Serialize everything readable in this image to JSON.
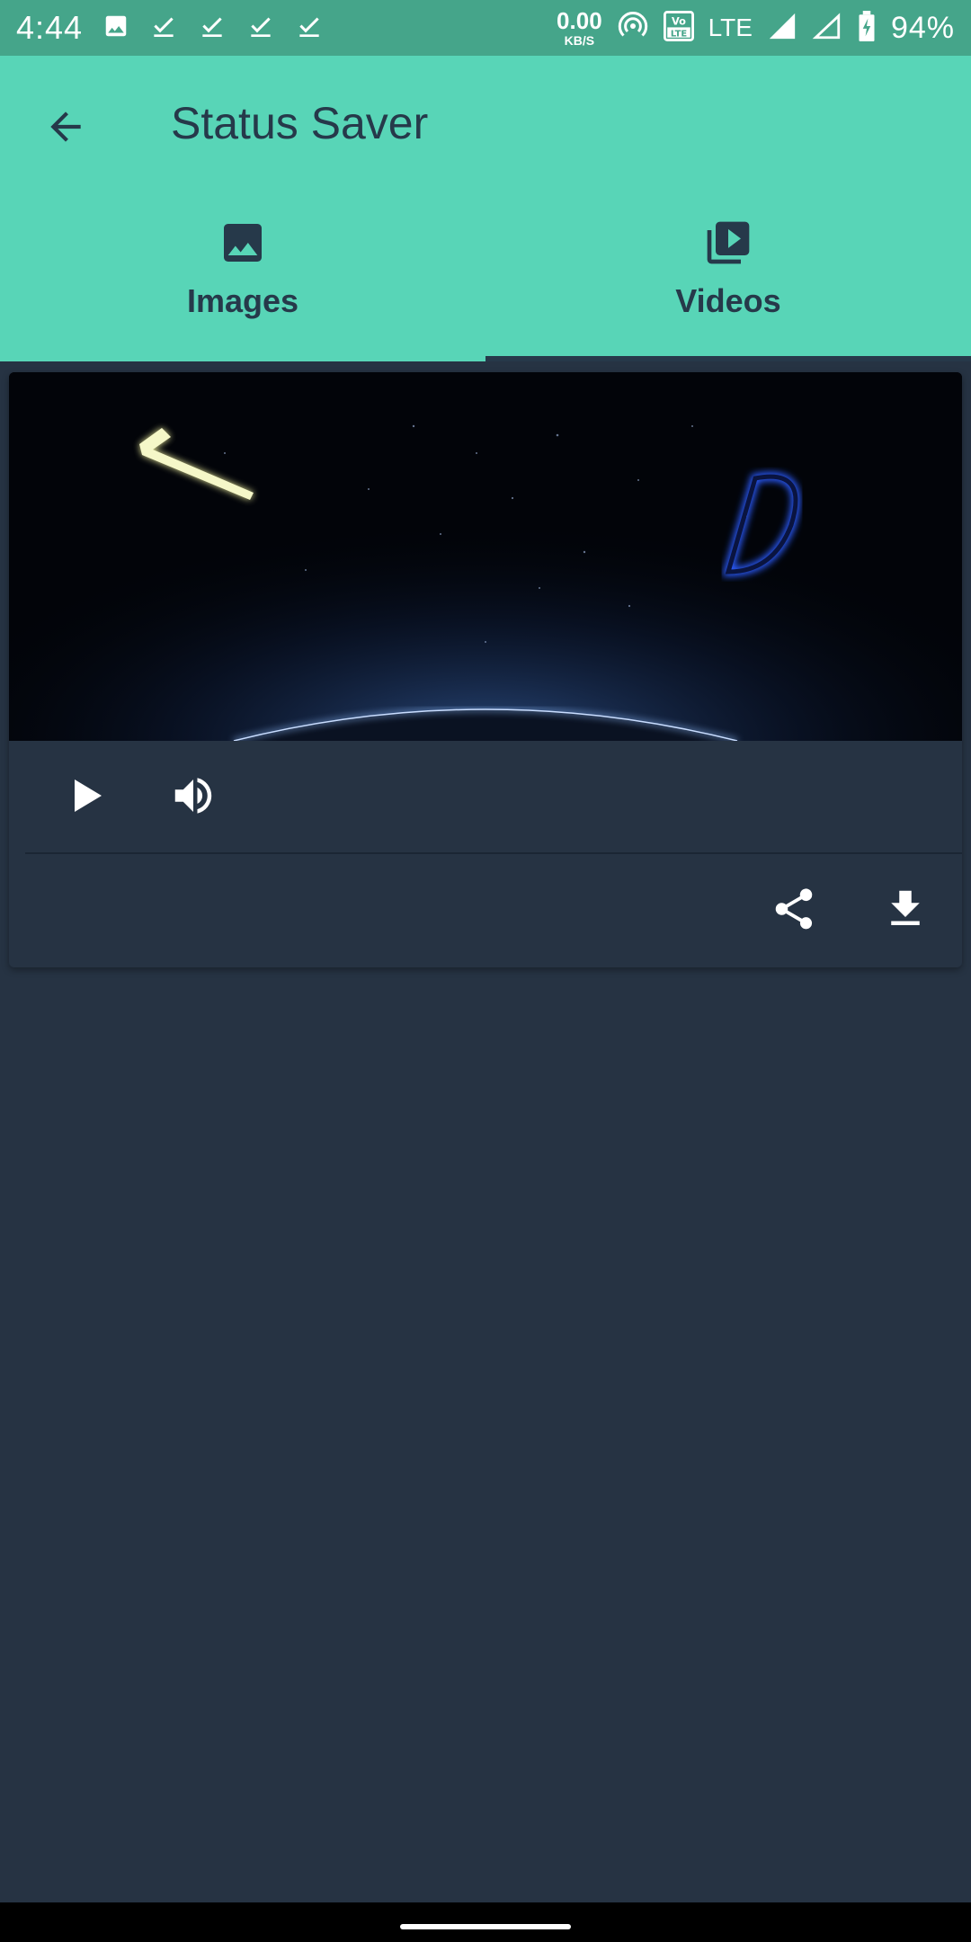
{
  "status_bar": {
    "time": "4:44",
    "net_speed_value": "0.00",
    "net_speed_unit": "KB/S",
    "volte": "VoLTE",
    "network": "LTE",
    "battery": "94%",
    "notification_icons": [
      "image-icon",
      "check-icon",
      "check-icon",
      "check-icon",
      "check-icon"
    ]
  },
  "app_bar": {
    "title": "Status Saver",
    "background_color": "#58d5b7",
    "text_color": "#26394a"
  },
  "tabs": [
    {
      "label": "Images",
      "icon": "image-icon",
      "selected": false
    },
    {
      "label": "Videos",
      "icon": "video-library-icon",
      "selected": true
    }
  ],
  "video_card": {
    "controls": {
      "play_icon": "play-icon",
      "volume_icon": "volume-up-icon"
    },
    "actions": {
      "share_icon": "share-icon",
      "download_icon": "download-icon"
    }
  },
  "colors": {
    "status_bar": "#45a58a",
    "body_background": "#263343"
  }
}
